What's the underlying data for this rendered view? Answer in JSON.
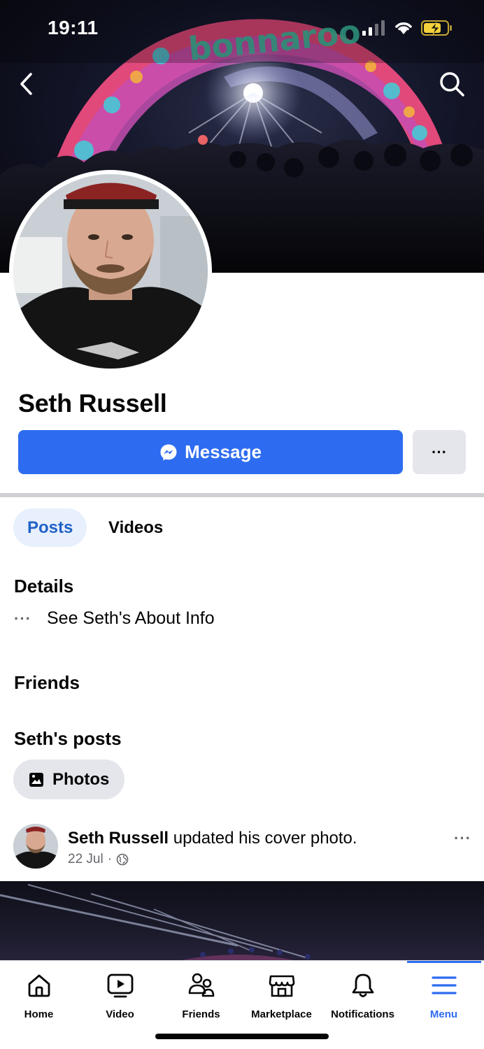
{
  "status_bar": {
    "time": "19:11"
  },
  "cover": {
    "arch_text": "bonnaroo"
  },
  "profile": {
    "name": "Seth Russell",
    "message_label": "Message",
    "more_label": "···"
  },
  "tabs": [
    {
      "label": "Posts",
      "active": true
    },
    {
      "label": "Videos",
      "active": false
    }
  ],
  "details": {
    "title": "Details",
    "about_dots": "···",
    "about_label": "See Seth's About Info"
  },
  "friends": {
    "title": "Friends"
  },
  "posts": {
    "title": "Seth's posts",
    "chip_label": "Photos",
    "items": [
      {
        "author": "Seth Russell",
        "action": " updated his cover photo.",
        "date": "22 Jul",
        "separator": "·",
        "privacy_icon": "globe-icon",
        "more_label": "···"
      }
    ]
  },
  "bottom_nav": [
    {
      "label": "Home",
      "icon": "home-icon",
      "active": false
    },
    {
      "label": "Video",
      "icon": "video-icon",
      "active": false
    },
    {
      "label": "Friends",
      "icon": "friends-icon",
      "active": false
    },
    {
      "label": "Marketplace",
      "icon": "marketplace-icon",
      "active": false
    },
    {
      "label": "Notifications",
      "icon": "bell-icon",
      "active": false
    },
    {
      "label": "Menu",
      "icon": "menu-icon",
      "active": true
    }
  ],
  "colors": {
    "accent": "#2d6cf0",
    "tab_active_bg": "#e7f0fc",
    "tab_active_text": "#2062c8",
    "secondary_button_bg": "#e4e6eb",
    "battery_charging": "#f2d13a"
  }
}
